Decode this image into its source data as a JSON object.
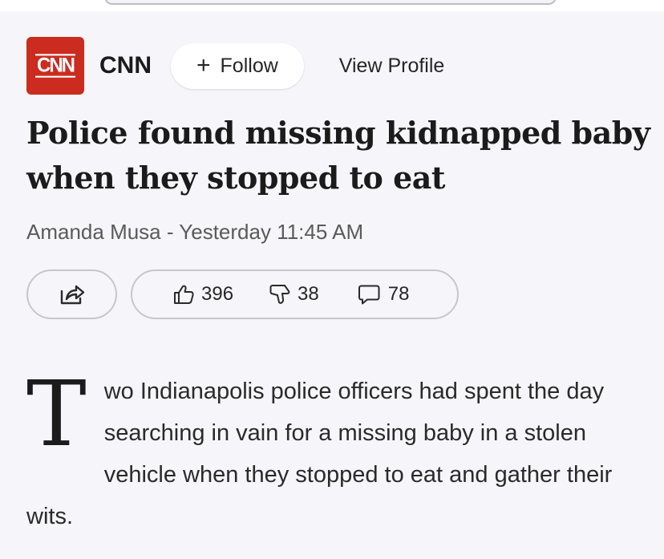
{
  "source": {
    "logo_text": "CNN",
    "name": "CNN",
    "brand_color": "#cc2b1f"
  },
  "actions": {
    "follow_icon": "+",
    "follow_label": "Follow",
    "view_profile_label": "View Profile"
  },
  "article": {
    "headline": "Police found missing kidnapped baby when they stopped to eat",
    "byline": "Amanda Musa - Yesterday 11:45 AM",
    "dropcap": "T",
    "body_rest": "wo Indianapolis police officers had spent the day searching in vain for a missing baby in a stolen vehicle when they stopped to eat and gather their wits."
  },
  "engagement": {
    "share_icon": "share-icon",
    "likes": "396",
    "dislikes": "38",
    "comments": "78"
  }
}
